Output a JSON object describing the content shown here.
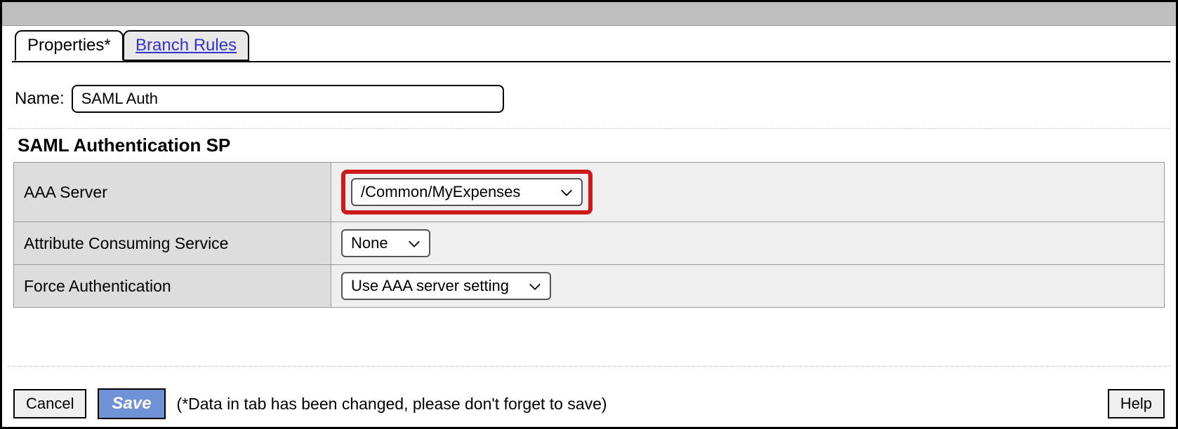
{
  "tabs": {
    "properties": "Properties*",
    "branch_rules": "Branch Rules"
  },
  "name_label": "Name:",
  "name_value": "SAML Auth",
  "section_title": "SAML Authentication SP",
  "rows": {
    "aaa_server": {
      "label": "AAA Server",
      "value": "/Common/MyExpenses"
    },
    "attr_consume": {
      "label": "Attribute Consuming Service",
      "value": "None"
    },
    "force_auth": {
      "label": "Force Authentication",
      "value": "Use AAA server setting"
    }
  },
  "footer": {
    "cancel": "Cancel",
    "save": "Save",
    "note": "(*Data in tab has been changed, please don't forget to save)",
    "help": "Help"
  }
}
